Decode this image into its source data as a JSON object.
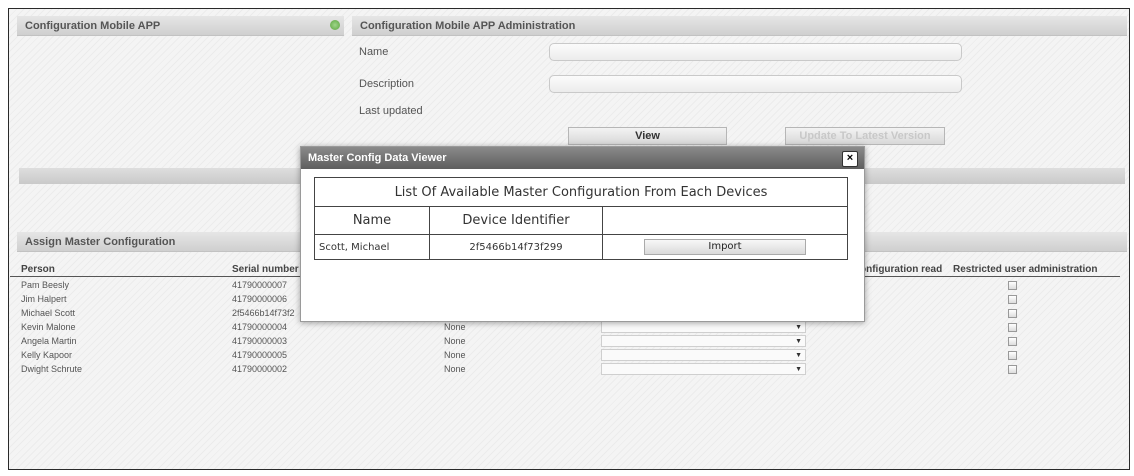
{
  "left_panel": {
    "title": "Configuration Mobile APP"
  },
  "admin_panel": {
    "title": "Configuration Mobile APP Administration",
    "name_label": "Name",
    "name_value": "",
    "description_label": "Description",
    "description_value": "",
    "last_updated_label": "Last updated",
    "view_button": "View",
    "update_button": "Update To Latest Version"
  },
  "assign_panel": {
    "title": "Assign Master Configuration",
    "columns": [
      "Person",
      "Serial number",
      "onfiguration read",
      "Restricted user administration"
    ],
    "rows": [
      {
        "person": "Pam Beesly",
        "serial": "41790000007",
        "status": "",
        "restricted": false
      },
      {
        "person": "Jim Halpert",
        "serial": "41790000006",
        "status": "",
        "restricted": false
      },
      {
        "person": "Michael Scott",
        "serial": "2f5466b14f73f2",
        "status": "",
        "restricted": false
      },
      {
        "person": "Kevin Malone",
        "serial": "41790000004",
        "status": "None",
        "restricted": false
      },
      {
        "person": "Angela Martin",
        "serial": "41790000003",
        "status": "None",
        "restricted": false
      },
      {
        "person": "Kelly Kapoor",
        "serial": "41790000005",
        "status": "None",
        "restricted": false
      },
      {
        "person": "Dwight Schrute",
        "serial": "41790000002",
        "status": "None",
        "restricted": false
      }
    ]
  },
  "modal": {
    "title": "Master Config Data Viewer",
    "close": "×",
    "table_caption": "List Of Available Master Configuration From Each Devices",
    "col_name": "Name",
    "col_device": "Device Identifier",
    "rows": [
      {
        "name": "Scott, Michael",
        "device": "2f5466b14f73f299",
        "action": "Import"
      }
    ]
  }
}
